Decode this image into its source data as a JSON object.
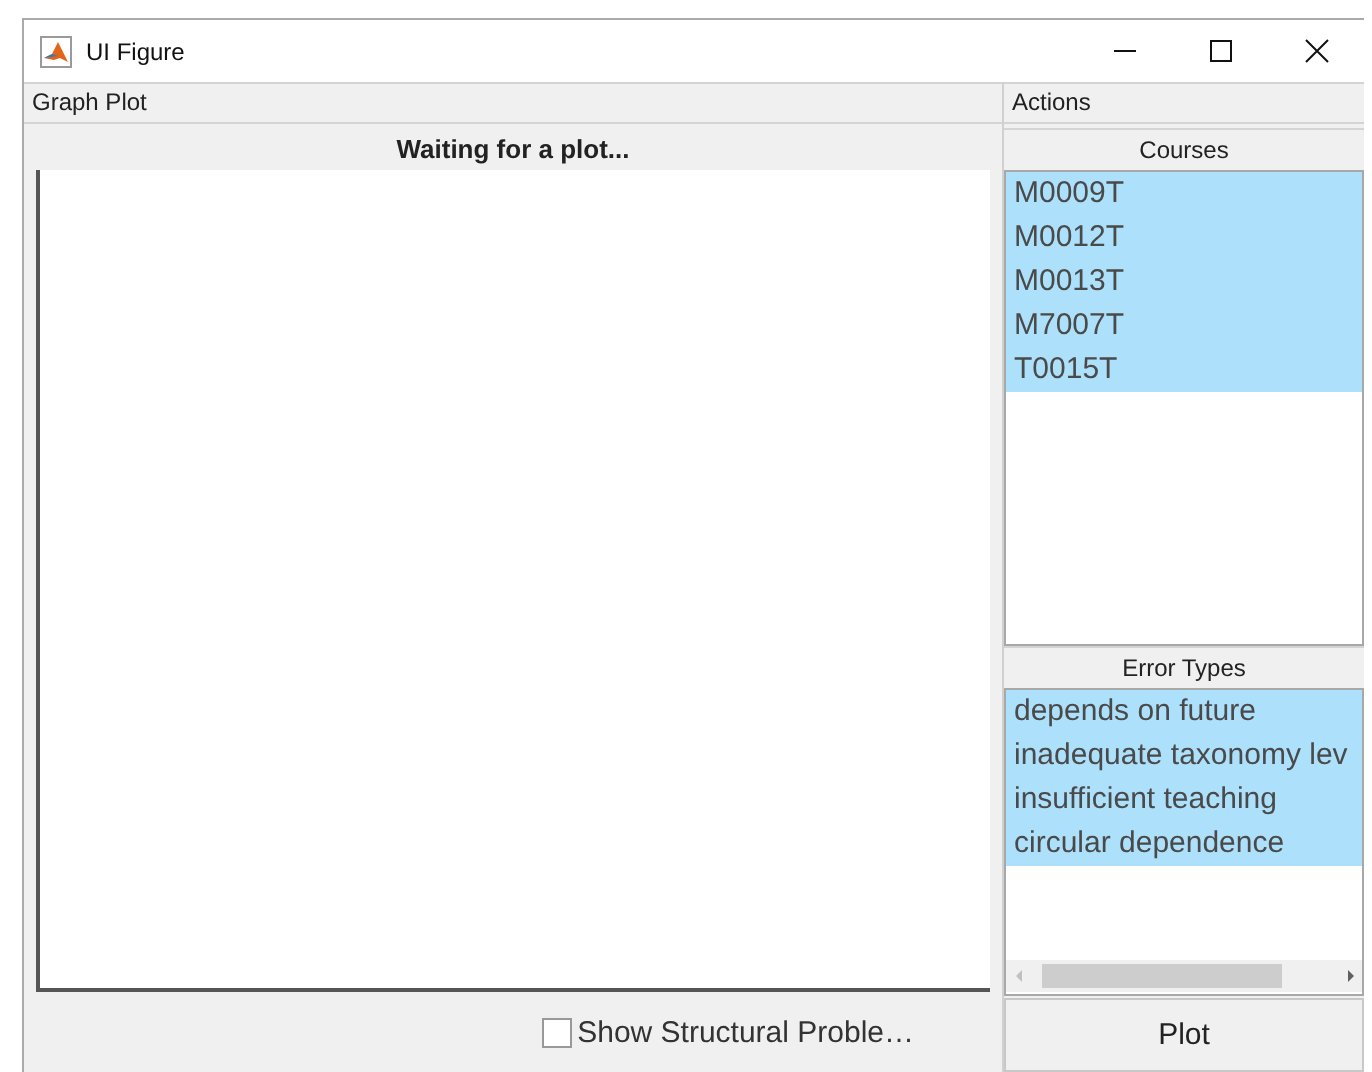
{
  "window": {
    "title": "UI Figure"
  },
  "graph_panel": {
    "title": "Graph Plot",
    "axes_title": "Waiting for a plot...",
    "checkbox": {
      "label": "Show Structural Proble…",
      "checked": false
    }
  },
  "actions_panel": {
    "title": "Actions",
    "courses": {
      "title": "Courses",
      "items": [
        {
          "label": "M0009T",
          "selected": true
        },
        {
          "label": "M0012T",
          "selected": true
        },
        {
          "label": "M0013T",
          "selected": true
        },
        {
          "label": "M7007T",
          "selected": true
        },
        {
          "label": "T0015T",
          "selected": true
        }
      ]
    },
    "error_types": {
      "title": "Error Types",
      "items": [
        {
          "label": "depends on future",
          "selected": true
        },
        {
          "label": "inadequate taxonomy lev",
          "selected": true
        },
        {
          "label": "insufficient teaching",
          "selected": true
        },
        {
          "label": "circular dependence",
          "selected": true
        }
      ]
    },
    "button": "Plot"
  }
}
